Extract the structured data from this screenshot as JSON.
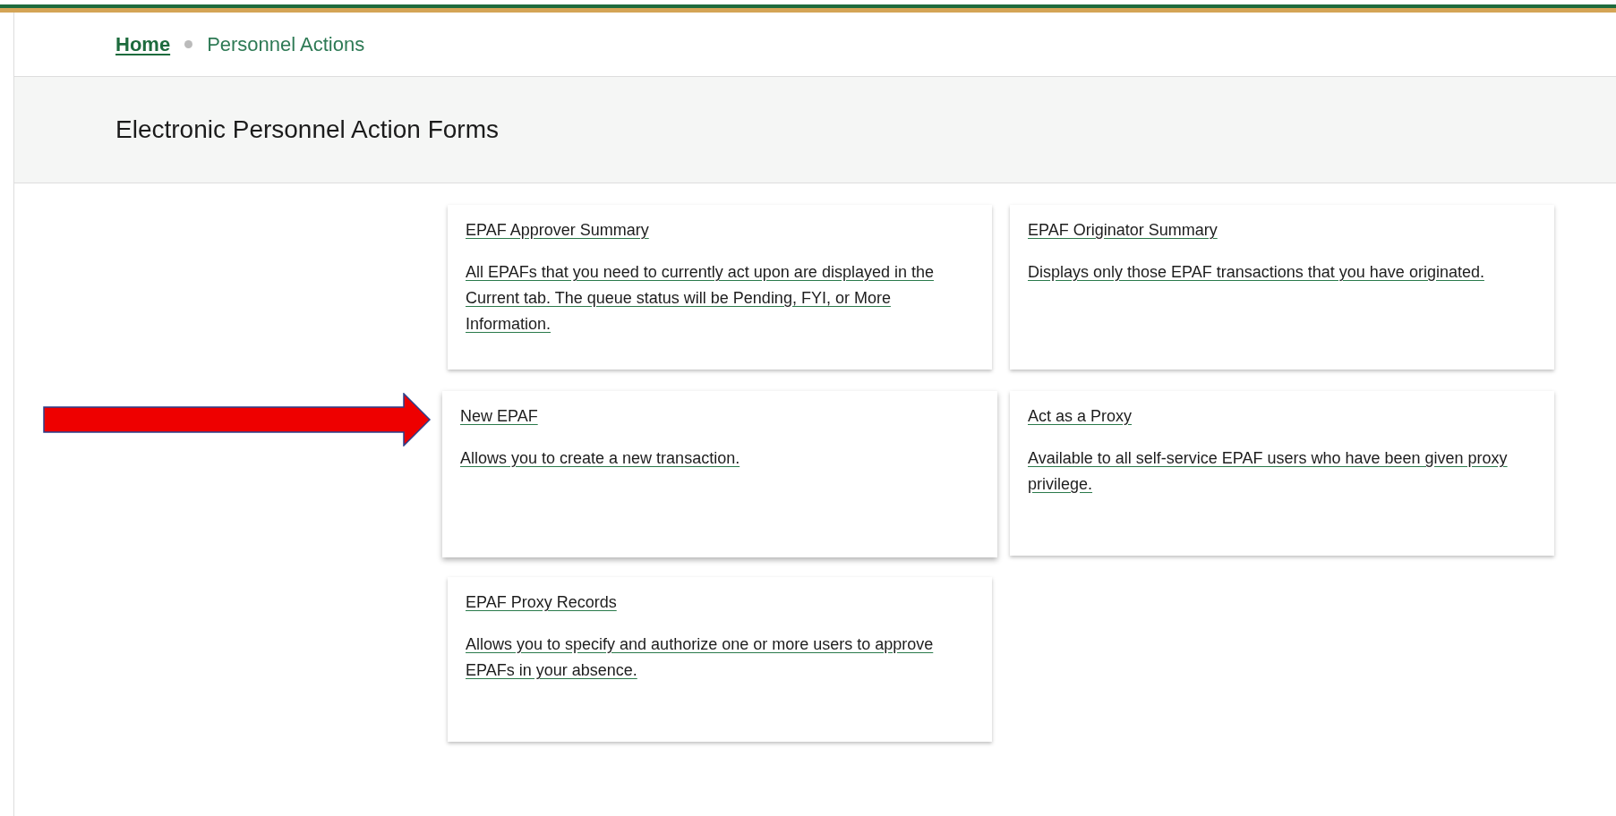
{
  "breadcrumb": [
    {
      "label": "Home",
      "kind": "link"
    },
    {
      "label": "Personnel Actions",
      "kind": "current"
    }
  ],
  "page_title": "Electronic Personnel Action Forms",
  "cards": [
    {
      "title": "EPAF Approver Summary",
      "description": "All EPAFs that you need to currently act upon are displayed in the Current tab. The queue status will be Pending, FYI, or More Information.",
      "highlighted": false
    },
    {
      "title": "EPAF Originator Summary",
      "description": "Displays only those EPAF transactions that you have originated.",
      "highlighted": false
    },
    {
      "title": "New EPAF",
      "description": "Allows you to create a new transaction.",
      "highlighted": true
    },
    {
      "title": "Act as a Proxy",
      "description": "Available to all self-service EPAF users who have been given proxy privilege.",
      "highlighted": false
    },
    {
      "title": "EPAF Proxy Records",
      "description": "Allows you to specify and authorize one or more users to approve EPAFs in your absence.",
      "highlighted": false
    }
  ]
}
